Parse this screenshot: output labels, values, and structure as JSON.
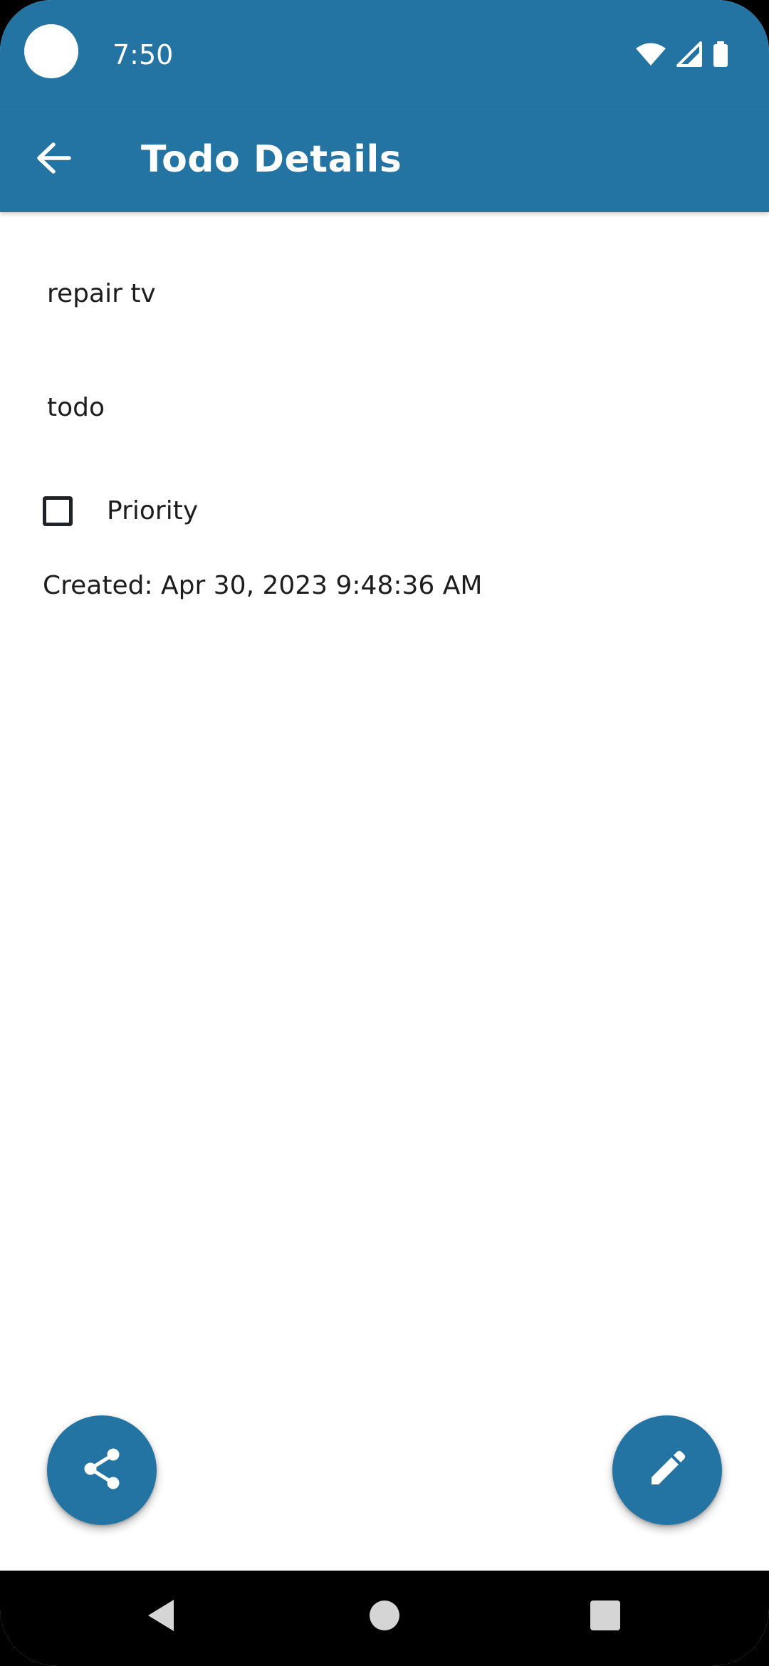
{
  "status_bar": {
    "time": "7:50",
    "icons": [
      "wifi-icon",
      "cellular-signal-icon",
      "battery-icon"
    ]
  },
  "app_bar": {
    "title": "Todo Details",
    "back_icon": "arrow-back-icon"
  },
  "todo": {
    "title": "repair tv",
    "description": "todo",
    "priority_label": "Priority",
    "priority_checked": false,
    "created": "Created: Apr 30, 2023 9:48:36 AM"
  },
  "fabs": {
    "share_icon": "share-icon",
    "edit_icon": "pencil-edit-icon"
  },
  "nav_bar": {
    "buttons": [
      "nav-back-icon",
      "nav-home-icon",
      "nav-recents-icon"
    ]
  },
  "colors": {
    "primary": "#2474a3",
    "on_primary": "#ffffff",
    "text": "#1d1d1d",
    "background": "#ffffff"
  }
}
